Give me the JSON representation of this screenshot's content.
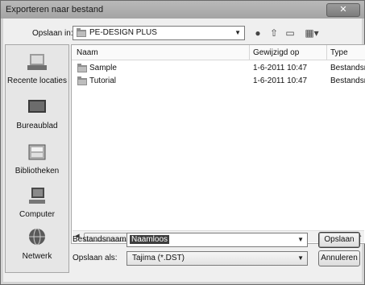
{
  "window": {
    "title": "Exporteren naar bestand",
    "close_label": "✕"
  },
  "lookin": {
    "label": "Opslaan in:",
    "value": "PE-DESIGN PLUS"
  },
  "places": [
    {
      "label": "Recente locaties",
      "icon": "recent-places-icon"
    },
    {
      "label": "Bureaublad",
      "icon": "desktop-icon"
    },
    {
      "label": "Bibliotheken",
      "icon": "libraries-icon"
    },
    {
      "label": "Computer",
      "icon": "computer-icon"
    },
    {
      "label": "Netwerk",
      "icon": "network-icon"
    }
  ],
  "list": {
    "columns": [
      "Naam",
      "Gewijzigd op",
      "Type"
    ],
    "rows": [
      {
        "name": "Sample",
        "modified": "1-6-2011 10:47",
        "type": "Bestandsn"
      },
      {
        "name": "Tutorial",
        "modified": "1-6-2011 10:47",
        "type": "Bestandsn"
      }
    ],
    "scroll_grip": "III"
  },
  "filename": {
    "label": "Bestandsnaam:",
    "value": "Naamloos"
  },
  "filetype": {
    "label": "Opslaan als:",
    "value": "Tajima (*.DST)"
  },
  "buttons": {
    "save": "Opslaan",
    "cancel": "Annuleren"
  }
}
